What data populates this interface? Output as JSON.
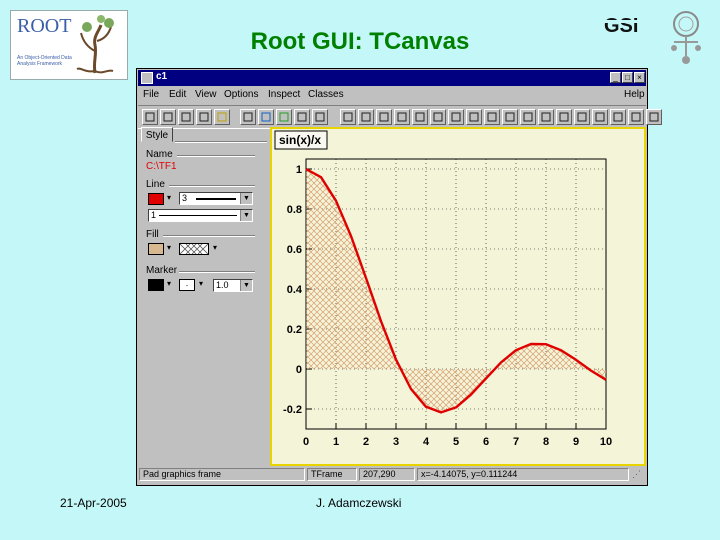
{
  "slide": {
    "title": "Root GUI: TCanvas",
    "footer_date": "21-Apr-2005",
    "footer_author": "J. Adamczewski",
    "root_logo_text": "ROOT",
    "root_logo_subtitle": "An Object-Oriented Data Analysis Framework",
    "gsi_logo_text": "GSI"
  },
  "window": {
    "title": "c1",
    "menus": [
      "File",
      "Edit",
      "View",
      "Options",
      "Inspect",
      "Classes"
    ],
    "help": "Help",
    "title_buttons": [
      "_",
      "□",
      "×"
    ]
  },
  "toolbar": {
    "icons": [
      "new-icon",
      "open-icon",
      "save-icon",
      "print-icon",
      "options-icon",
      "inspect-icon",
      "browser-icon",
      "refresh-icon",
      "help-icon",
      "about-icon",
      "pointer-icon",
      "undo-icon",
      "redo-icon",
      "arrow-icon",
      "diamond-icon",
      "ellipse-icon",
      "pad-icon",
      "pave-icon",
      "pavetext-icon",
      "label-icon",
      "line-icon",
      "tcut-icon",
      "gear-icon",
      "text-icon",
      "marker-icon",
      "graph-icon",
      "graph2-icon",
      "latex-icon"
    ]
  },
  "editor": {
    "tab": "Style",
    "name_label": "Name",
    "name_value": "C:\\TF1",
    "line_label": "Line",
    "line_color": "#e00000",
    "line_width": "3",
    "line_style": "1",
    "fill_label": "Fill",
    "fill_color": "#d8b890",
    "marker_label": "Marker",
    "marker_color": "#000000",
    "marker_style": "·",
    "marker_size": "1.0"
  },
  "status": {
    "cells": [
      "Pad graphics frame",
      "TFrame",
      "207,290",
      "x=-4.14075, y=0.111244"
    ]
  },
  "chart_data": {
    "type": "line",
    "title": "sin(x)/x",
    "xlim": [
      0,
      10
    ],
    "ylim": [
      -0.3,
      1.05
    ],
    "xticks": [
      "0",
      "1",
      "2",
      "3",
      "4",
      "5",
      "6",
      "7",
      "8",
      "9",
      "10"
    ],
    "yticks": [
      "-0.2",
      "0",
      "0.2",
      "0.4",
      "0.6",
      "0.8",
      "1"
    ],
    "grid": true,
    "fill": "hatched, tan",
    "line_color": "#e00000",
    "series": [
      {
        "x": [
          0,
          0.5,
          1,
          1.5,
          2,
          2.5,
          3,
          3.5,
          4,
          4.5,
          5,
          5.5,
          6,
          6.5,
          7,
          7.5,
          8,
          8.5,
          9,
          9.5,
          10
        ],
        "y": [
          1,
          0.959,
          0.841,
          0.665,
          0.455,
          0.239,
          0.047,
          -0.1,
          -0.189,
          -0.217,
          -0.192,
          -0.128,
          -0.047,
          0.033,
          0.094,
          0.125,
          0.124,
          0.094,
          0.046,
          -0.008,
          -0.054
        ]
      }
    ]
  }
}
